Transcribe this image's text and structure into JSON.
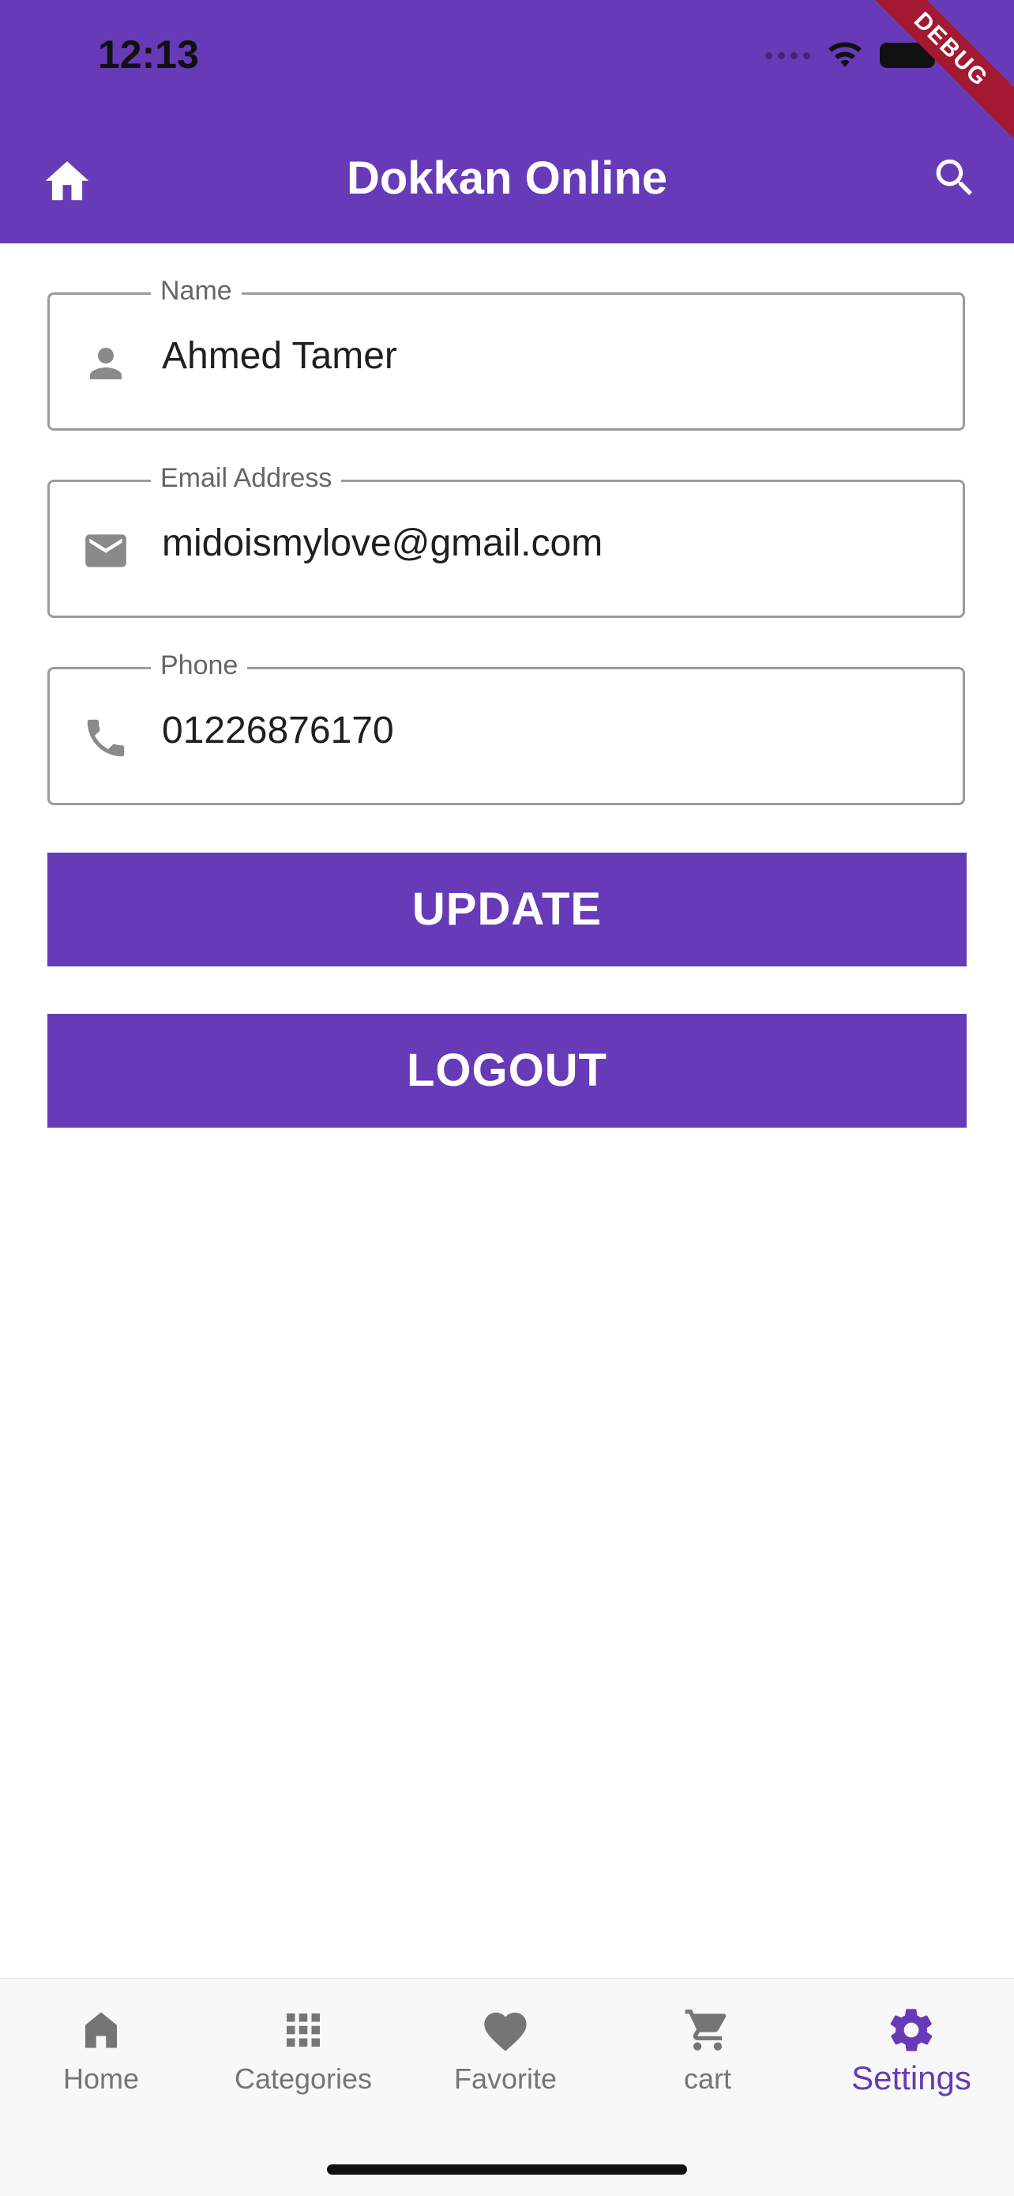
{
  "status_bar": {
    "time": "12:13"
  },
  "debug_banner": "DEBUG",
  "app_bar": {
    "title": "Dokkan Online",
    "leading_icon": "home-icon",
    "action_icon": "search-icon"
  },
  "form": {
    "name": {
      "label": "Name",
      "value": "Ahmed Tamer",
      "icon": "person-icon"
    },
    "email": {
      "label": "Email Address",
      "value": "midoismylove@gmail.com",
      "icon": "mail-icon"
    },
    "phone": {
      "label": "Phone",
      "value": "01226876170",
      "icon": "phone-icon"
    }
  },
  "buttons": {
    "update": "UPDATE",
    "logout": "LOGOUT"
  },
  "bottom_nav": {
    "active": "Settings",
    "items": [
      {
        "label": "Home",
        "icon": "home-icon"
      },
      {
        "label": "Categories",
        "icon": "apps-icon"
      },
      {
        "label": "Favorite",
        "icon": "heart-icon"
      },
      {
        "label": "cart",
        "icon": "cart-icon"
      },
      {
        "label": "Settings",
        "icon": "gear-icon"
      }
    ]
  },
  "colors": {
    "primary": "#673ab7",
    "debug": "#a31932",
    "inactive": "#757575",
    "border": "#9b9b9b"
  }
}
